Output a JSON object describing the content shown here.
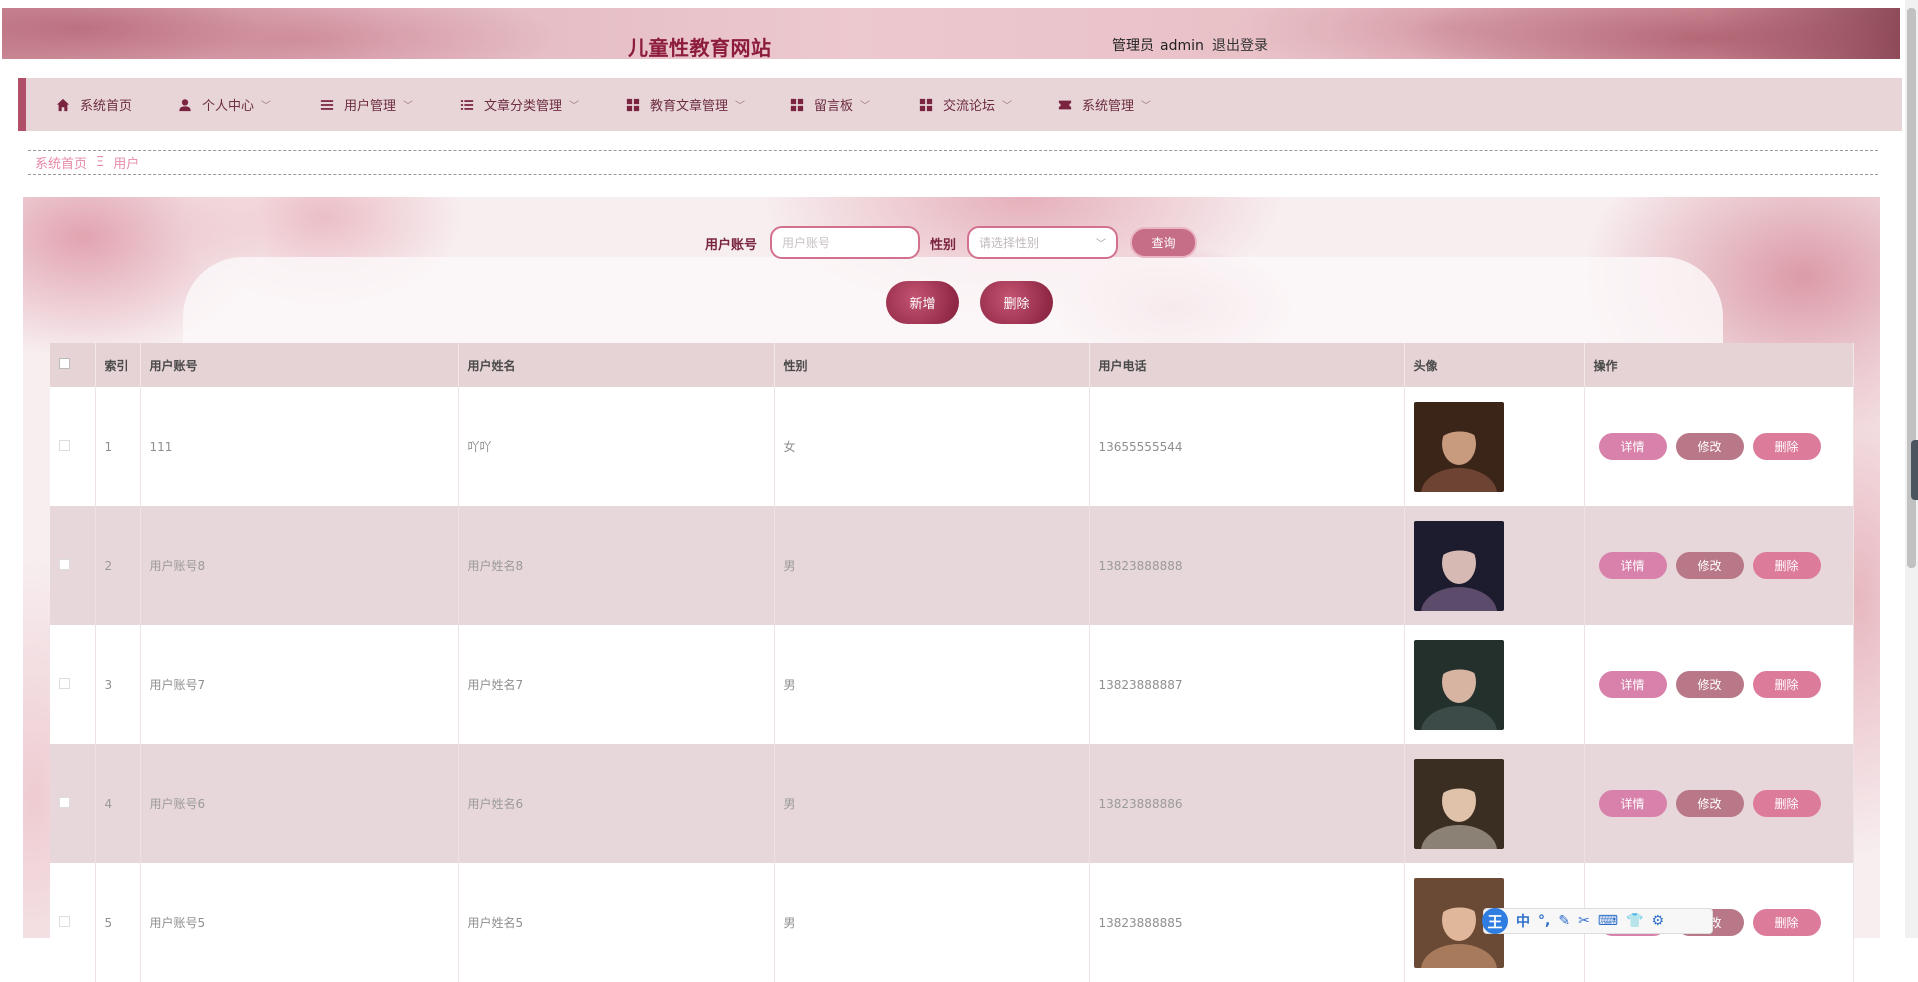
{
  "header": {
    "site_title": "儿童性教育网站",
    "role_label": "管理员",
    "username": "admin",
    "logout_label": "退出登录"
  },
  "nav": {
    "items": [
      {
        "label": "系统首页",
        "icon": "home-icon"
      },
      {
        "label": "个人中心",
        "icon": "user-icon"
      },
      {
        "label": "用户管理",
        "icon": "menu-icon"
      },
      {
        "label": "文章分类管理",
        "icon": "list-icon"
      },
      {
        "label": "教育文章管理",
        "icon": "grid-icon"
      },
      {
        "label": "留言板",
        "icon": "grid-icon"
      },
      {
        "label": "交流论坛",
        "icon": "grid-icon"
      },
      {
        "label": "系统管理",
        "icon": "ticket-icon"
      }
    ]
  },
  "breadcrumb": {
    "home": "系统首页",
    "separator": "Ξ",
    "current": "用户"
  },
  "search": {
    "account_label": "用户账号",
    "account_placeholder": "用户账号",
    "gender_label": "性别",
    "gender_placeholder": "请选择性别",
    "query_label": "查询"
  },
  "actions": {
    "add_label": "新增",
    "delete_label": "删除"
  },
  "table": {
    "columns": [
      "索引",
      "用户账号",
      "用户姓名",
      "性别",
      "用户电话",
      "头像",
      "操作"
    ],
    "rows": [
      {
        "index": "1",
        "account": "111",
        "name": "吖吖",
        "gender": "女",
        "phone": "13655555544",
        "avatar": "avatar-photo"
      },
      {
        "index": "2",
        "account": "用户账号8",
        "name": "用户姓名8",
        "gender": "男",
        "phone": "13823888888",
        "avatar": "avatar-photo"
      },
      {
        "index": "3",
        "account": "用户账号7",
        "name": "用户姓名7",
        "gender": "男",
        "phone": "13823888887",
        "avatar": "avatar-photo"
      },
      {
        "index": "4",
        "account": "用户账号6",
        "name": "用户姓名6",
        "gender": "男",
        "phone": "13823888886",
        "avatar": "avatar-photo"
      },
      {
        "index": "5",
        "account": "用户账号5",
        "name": "用户姓名5",
        "gender": "男",
        "phone": "13823888885",
        "avatar": "avatar-photo"
      }
    ],
    "op_detail": "详情",
    "op_edit": "修改",
    "op_delete": "删除"
  },
  "ime": {
    "logo": "王",
    "mode": "中"
  },
  "colors": {
    "accent": "#8c1b3c",
    "nav_bg": "#e8d5d8",
    "detail_btn": "#d882ab",
    "edit_btn": "#b97888",
    "delete_btn": "#dd7b9b"
  }
}
